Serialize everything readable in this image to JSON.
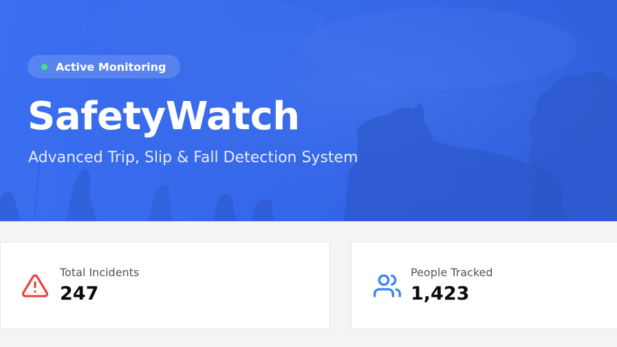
{
  "hero": {
    "badge_label": "Active Monitoring",
    "title": "SafetyWatch",
    "subtitle": "Advanced Trip, Slip & Fall Detection System"
  },
  "stats": [
    {
      "label": "Total Incidents",
      "value": "247",
      "icon": "alert-triangle-icon",
      "color": "#ef4444"
    },
    {
      "label": "People Tracked",
      "value": "1,423",
      "icon": "users-icon",
      "color": "#3b82f6"
    }
  ],
  "colors": {
    "hero_background": "#3567e9",
    "badge_dot": "#4ade80",
    "page_background": "#f3f4f6"
  }
}
